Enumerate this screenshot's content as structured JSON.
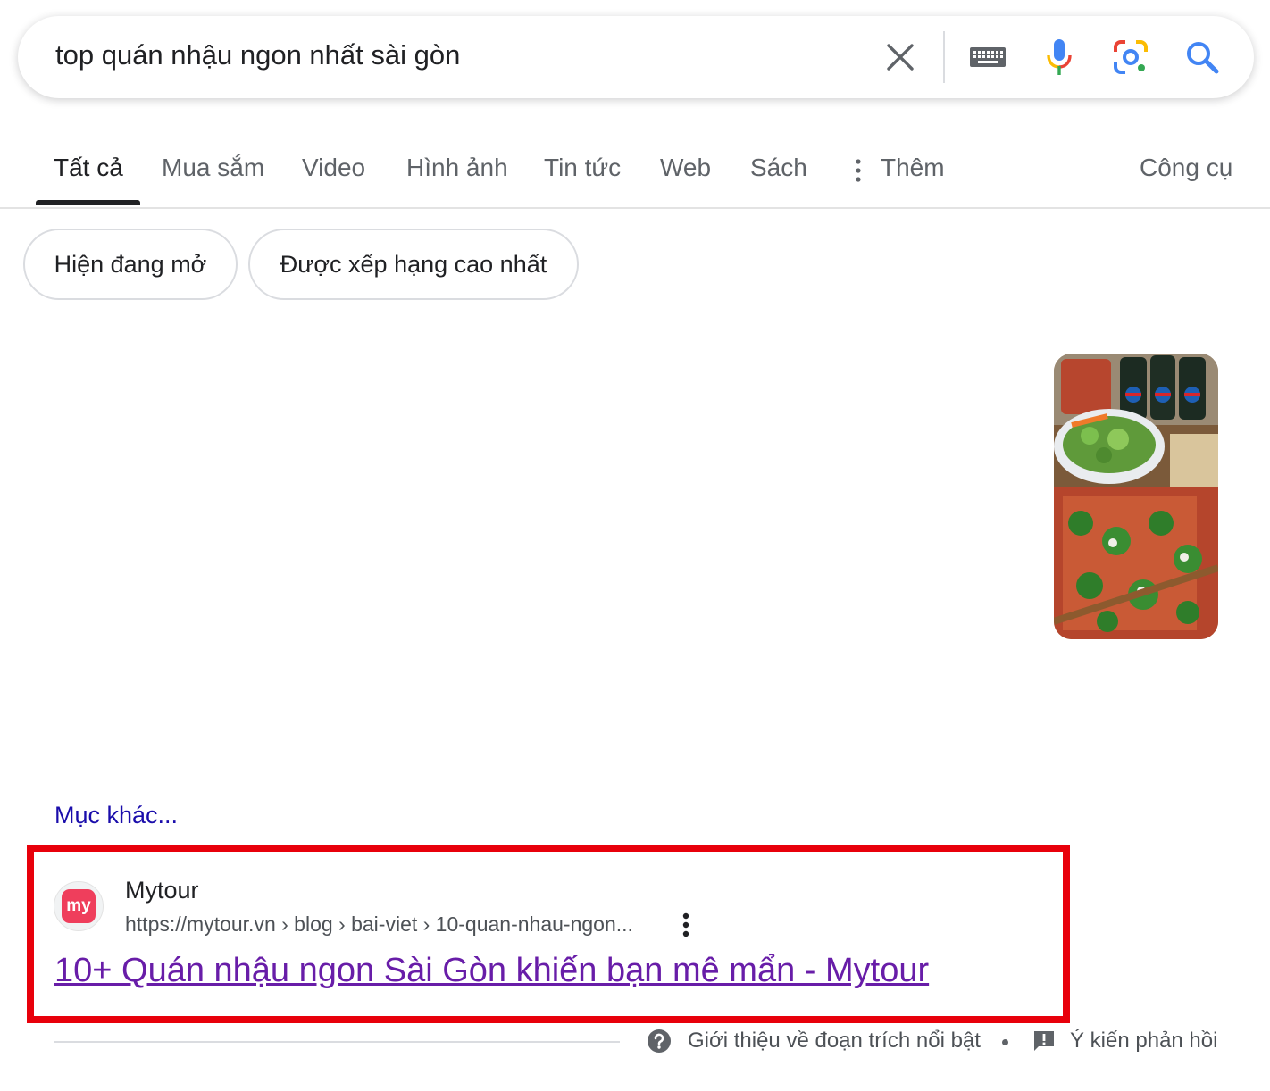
{
  "search": {
    "query": "top quán nhậu ngon nhất sài gòn",
    "icons": [
      "close-icon",
      "keyboard-icon",
      "microphone-icon",
      "google-lens-icon",
      "search-icon"
    ]
  },
  "tabs": {
    "items": [
      {
        "label": "Tất cả",
        "active": true
      },
      {
        "label": "Mua sắm"
      },
      {
        "label": "Video"
      },
      {
        "label": "Hình ảnh"
      },
      {
        "label": "Tin tức"
      },
      {
        "label": "Web"
      },
      {
        "label": "Sách"
      },
      {
        "label": "Thêm",
        "icon": "more-vertical-icon"
      }
    ],
    "tools_label": "Công cụ"
  },
  "chips": [
    {
      "label": "Hiện đang mở"
    },
    {
      "label": "Được xếp hạng cao nhất"
    }
  ],
  "more_link": "Mục khác...",
  "result": {
    "favicon_text": "my",
    "site_name": "Mytour",
    "url": "https://mytour.vn › blog › bai-viet › 10-quan-nhau-ngon...",
    "title": "10+ Quán nhậu ngon Sài Gòn khiến bạn mê mẩn - Mytour",
    "highlight_color": "#e8000b"
  },
  "footer": {
    "about_label": "Giới thiệu về đoạn trích nổi bật",
    "feedback_label": "Ý kiến phản hồi"
  },
  "colors": {
    "link": "#1a0dab",
    "visited_title": "#681da8",
    "google_blue": "#4285f4",
    "google_red": "#ea4335",
    "google_yellow": "#fbbc04",
    "google_green": "#34a853"
  }
}
